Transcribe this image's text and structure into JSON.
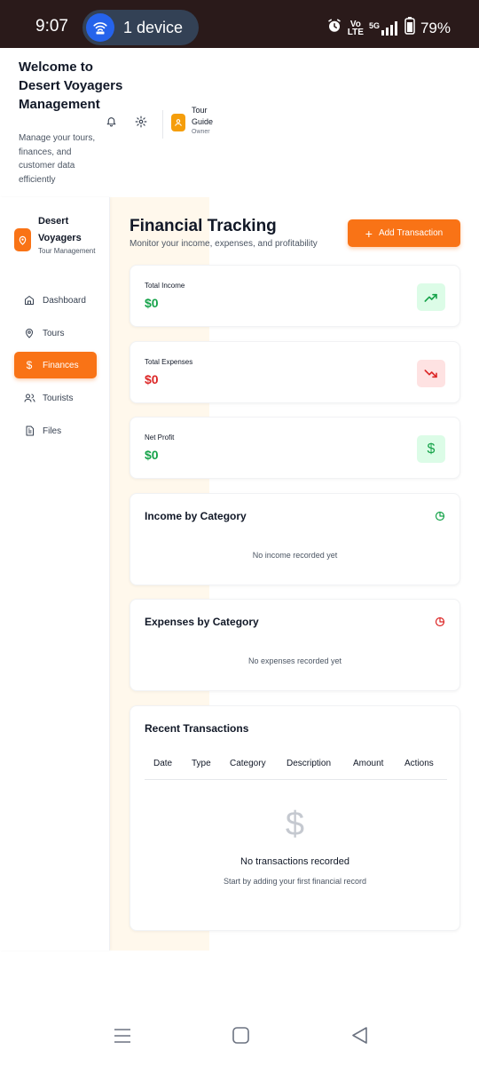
{
  "status_bar": {
    "time": "9:07",
    "device_label": "1 device",
    "network_volte_top": "Vo",
    "network_volte_bottom": "LTE",
    "network_type": "5G",
    "battery": "79%"
  },
  "header": {
    "welcome_title": "Welcome to Desert Voyagers Management",
    "welcome_subtitle": "Manage your tours, finances, and customer data efficiently",
    "user_role": "Tour Guide",
    "user_status": "Owner"
  },
  "sidebar": {
    "brand_name": "Desert Voyagers",
    "brand_subtitle": "Tour Management",
    "items": [
      {
        "label": "Dashboard",
        "icon": "home-icon"
      },
      {
        "label": "Tours",
        "icon": "map-pin-icon"
      },
      {
        "label": "Finances",
        "icon": "dollar-icon",
        "active": true
      },
      {
        "label": "Tourists",
        "icon": "users-icon"
      },
      {
        "label": "Files",
        "icon": "file-icon"
      }
    ]
  },
  "main": {
    "title": "Financial Tracking",
    "subtitle": "Monitor your income, expenses, and profitability",
    "add_button": "Add Transaction",
    "stats": [
      {
        "label": "Total Income",
        "value": "$0",
        "color": "#16a34a",
        "icon": "trending-up-icon"
      },
      {
        "label": "Total Expenses",
        "value": "$0",
        "color": "#dc2626",
        "icon": "trending-down-icon"
      },
      {
        "label": "Net Profit",
        "value": "$0",
        "color": "#16a34a",
        "icon": "dollar-icon"
      }
    ],
    "income_category": {
      "title": "Income by Category",
      "empty": "No income recorded yet"
    },
    "expense_category": {
      "title": "Expenses by Category",
      "empty": "No expenses recorded yet"
    },
    "transactions": {
      "title": "Recent Transactions",
      "columns": [
        "Date",
        "Type",
        "Category",
        "Description",
        "Amount",
        "Actions"
      ],
      "empty_symbol": "$",
      "empty_title": "No transactions recorded",
      "empty_subtitle": "Start by adding your first financial record"
    }
  },
  "colors": {
    "accent": "#f97316",
    "income": "#16a34a",
    "expense": "#dc2626",
    "page_tint": "#fff8ec"
  }
}
